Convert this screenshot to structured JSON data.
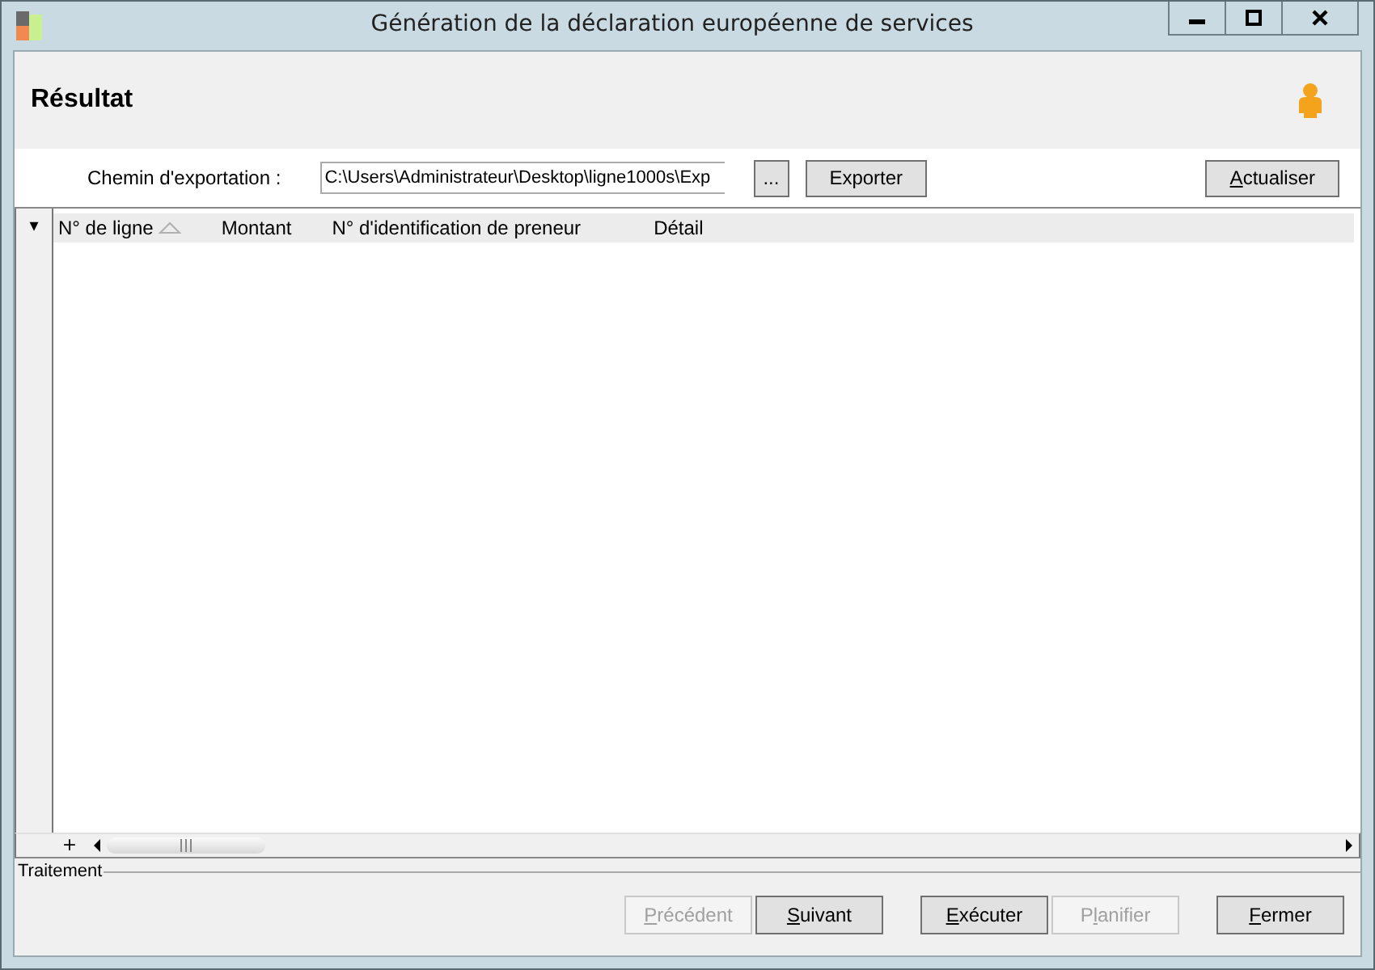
{
  "window": {
    "title": "Génération de la déclaration européenne de services"
  },
  "header": {
    "title": "Résultat"
  },
  "export": {
    "label": "Chemin d'exportation :",
    "path": "C:\\Users\\Administrateur\\Desktop\\ligne1000s\\Exp",
    "browse": "...",
    "export_button": "Exporter",
    "refresh": {
      "mnemonic": "A",
      "after": "ctualiser"
    }
  },
  "table": {
    "row_menu": "▾",
    "columns": [
      {
        "label": "N° de ligne",
        "sorted": true
      },
      {
        "label": "Montant",
        "sorted": false
      },
      {
        "label": "N° d'identification de preneur",
        "sorted": false
      },
      {
        "label": "Détail",
        "sorted": false
      }
    ],
    "add": "+"
  },
  "group": {
    "title": "Traitement"
  },
  "buttons": [
    {
      "mnemonic": "P",
      "after": "récédent",
      "disabled": true
    },
    {
      "mnemonic": "S",
      "after": "uivant",
      "disabled": false
    },
    {
      "mnemonic": "E",
      "after": "xécuter",
      "disabled": false
    },
    {
      "before": "P",
      "mnemonic": "l",
      "after": "anifier",
      "disabled": true
    },
    {
      "mnemonic": "F",
      "after": "ermer",
      "disabled": false
    }
  ]
}
